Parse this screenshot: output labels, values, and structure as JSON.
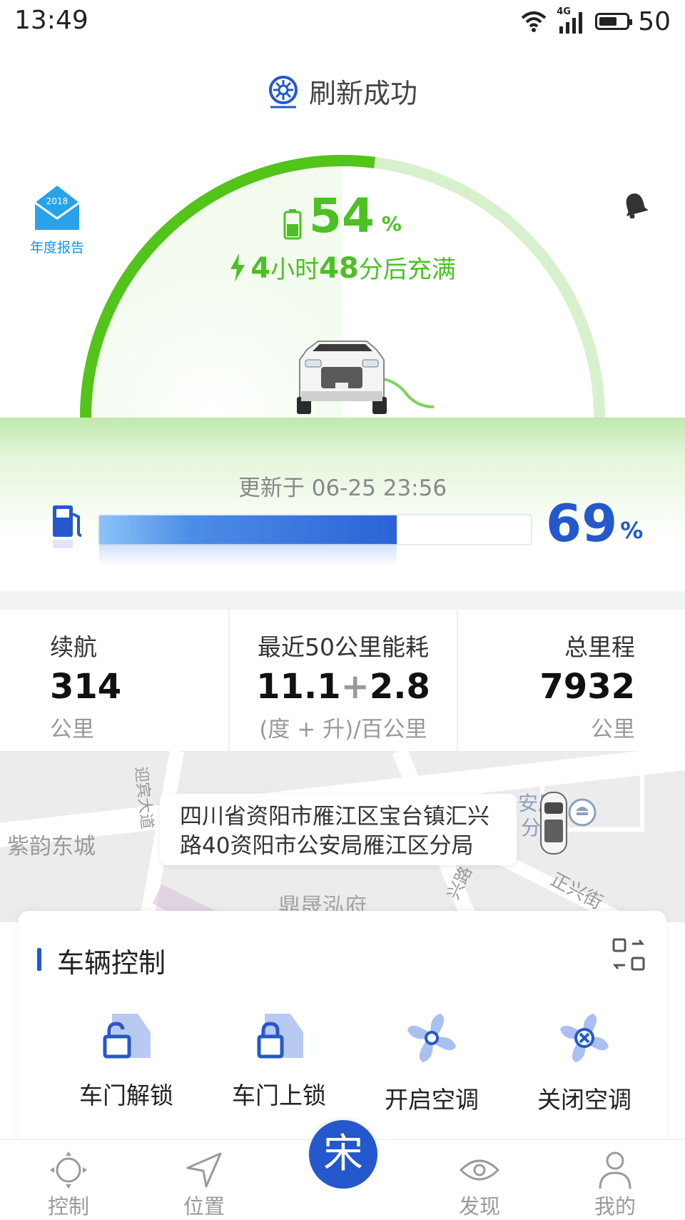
{
  "status_bar": {
    "time": "13:49",
    "network": "4G",
    "battery": "50"
  },
  "refresh": {
    "text": "刷新成功"
  },
  "report": {
    "year": "2018",
    "label": "年度报告"
  },
  "battery": {
    "percent": "54",
    "unit": "%",
    "level_fraction": 0.54
  },
  "charge": {
    "hours": "4",
    "hours_unit": "小时",
    "minutes": "48",
    "suffix": "分后充满"
  },
  "update": {
    "text": "更新于 06-25 23:56"
  },
  "fuel": {
    "percent": "69",
    "unit": "%",
    "level_fraction": 0.69
  },
  "stats": {
    "range": {
      "label": "续航",
      "value": "314",
      "unit": "公里"
    },
    "energy": {
      "label": "最近50公里能耗",
      "value_a": "11.1",
      "plus": "+",
      "value_b": "2.8",
      "unit": "(度 + 升)/百公里"
    },
    "total": {
      "label": "总里程",
      "value": "7932",
      "unit": "公里"
    }
  },
  "map": {
    "address_line1": "四川省资阳市雁江区宝台镇汇兴",
    "address_line2": "路40资阳市公安局雁江区分局",
    "labels": {
      "ziyun": "紫韵东城",
      "dingsheng": "鼎晟泓府",
      "anju": "安局",
      "fen": "分",
      "zhengxing": "正兴街",
      "road_left": "迎宾大道",
      "road_mid": "兴路"
    }
  },
  "controls": {
    "title": "车辆控制",
    "items": [
      {
        "label": "车门解锁",
        "icon": "door-unlock-icon"
      },
      {
        "label": "车门上锁",
        "icon": "door-lock-icon"
      },
      {
        "label": "开启空调",
        "icon": "ac-on-icon"
      },
      {
        "label": "关闭空调",
        "icon": "ac-off-icon"
      }
    ]
  },
  "tabs": [
    {
      "label": "控制",
      "icon": "steering-icon"
    },
    {
      "label": "位置",
      "icon": "location-arrow-icon"
    },
    {
      "label": "宋",
      "icon": "home-logo"
    },
    {
      "label": "发现",
      "icon": "eye-icon"
    },
    {
      "label": "我的",
      "icon": "person-icon"
    }
  ],
  "colors": {
    "green": "#4bc124",
    "blue": "#2458cc",
    "light_blue": "#1e8fe0",
    "gray_text": "#999999"
  }
}
